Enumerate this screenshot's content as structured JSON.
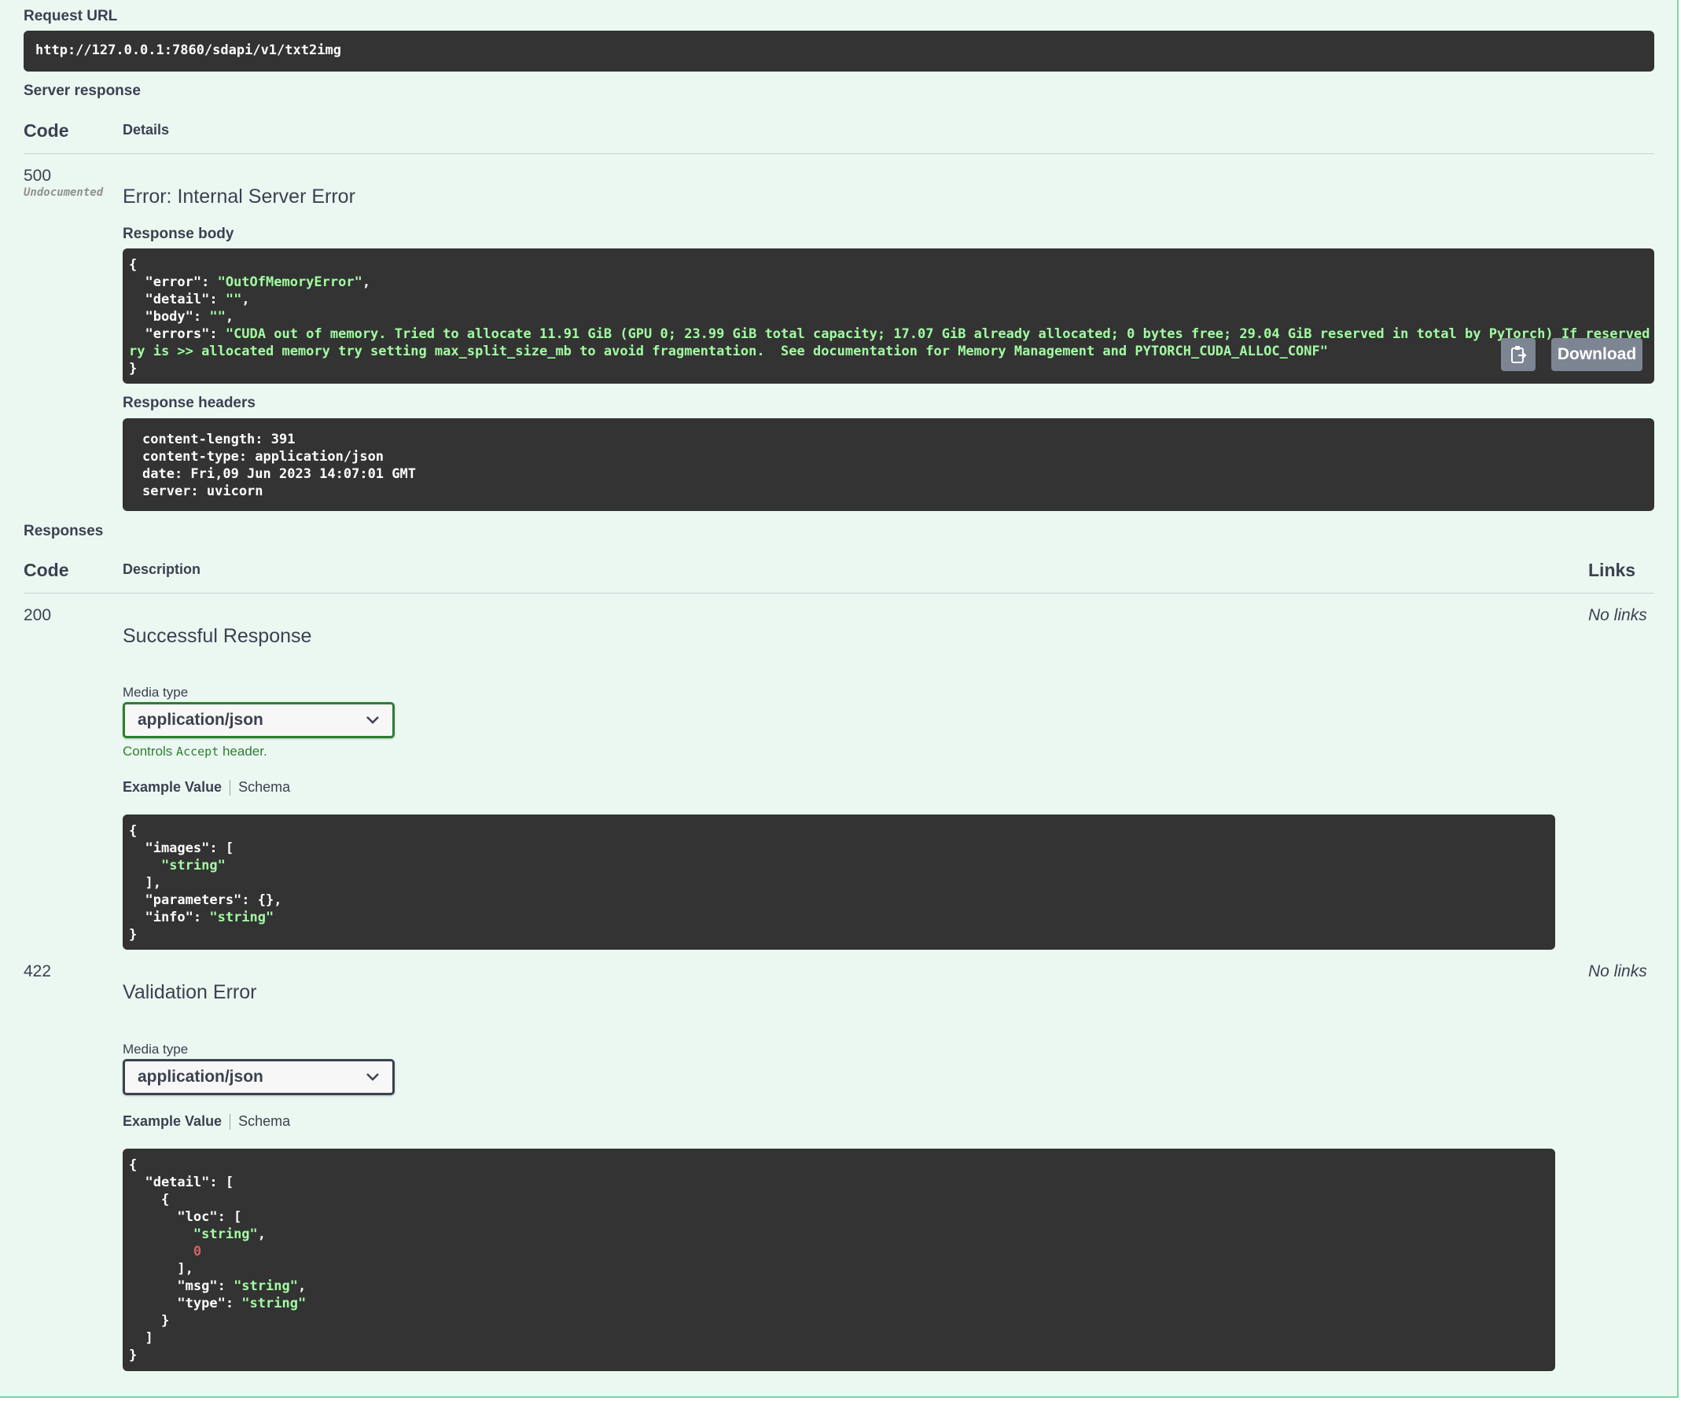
{
  "request_url": {
    "label": "Request URL",
    "value": "http://127.0.0.1:7860/sdapi/v1/txt2img"
  },
  "server_response": {
    "label": "Server response",
    "col_code": "Code",
    "col_details": "Details",
    "code": "500",
    "undocumented": "Undocumented",
    "error_title": "Error: Internal Server Error",
    "body_label": "Response body",
    "body_lines": [
      "{",
      "  \"error\": \"OutOfMemoryError\",",
      "  \"detail\": \"\",",
      "  \"body\": \"\",",
      "  \"errors\": \"CUDA out of memory. Tried to allocate 11.91 GiB (GPU 0; 23.99 GiB total capacity; 17.07 GiB already allocated; 0 bytes free; 29.04 GiB reserved in total by PyTorch) If reserved memo",
      "ry is >> allocated memory try setting max_split_size_mb to avoid fragmentation.  See documentation for Memory Management and PYTORCH_CUDA_ALLOC_CONF\"",
      "}"
    ],
    "download_label": "Download",
    "headers_label": "Response headers",
    "headers_lines": [
      "content-length: 391",
      "content-type: application/json",
      "date: Fri,09 Jun 2023 14:07:01 GMT",
      "server: uvicorn"
    ]
  },
  "responses": {
    "label": "Responses",
    "col_code": "Code",
    "col_description": "Description",
    "col_links": "Links",
    "items": [
      {
        "code": "200",
        "title": "Successful Response",
        "links": "No links",
        "media_type_label": "Media type",
        "media_type_value": "application/json",
        "controls_prefix": "Controls",
        "controls_code": "Accept",
        "controls_suffix": "header.",
        "tab_example": "Example Value",
        "tab_schema": "Schema"
      },
      {
        "code": "422",
        "title": "Validation Error",
        "links": "No links",
        "media_type_label": "Media type",
        "media_type_value": "application/json",
        "tab_example": "Example Value",
        "tab_schema": "Schema"
      }
    ]
  },
  "icons": {
    "copy": "clipboard-icon",
    "select_arrow": "chevron-down-icon"
  },
  "colors": {
    "panel_bg": "#ebf8f1",
    "panel_border": "#7fd3ab",
    "code_bg": "#333333",
    "string_green": "#a2fca2",
    "number_red": "#d36363",
    "select_border_focus": "#2f7d32"
  }
}
